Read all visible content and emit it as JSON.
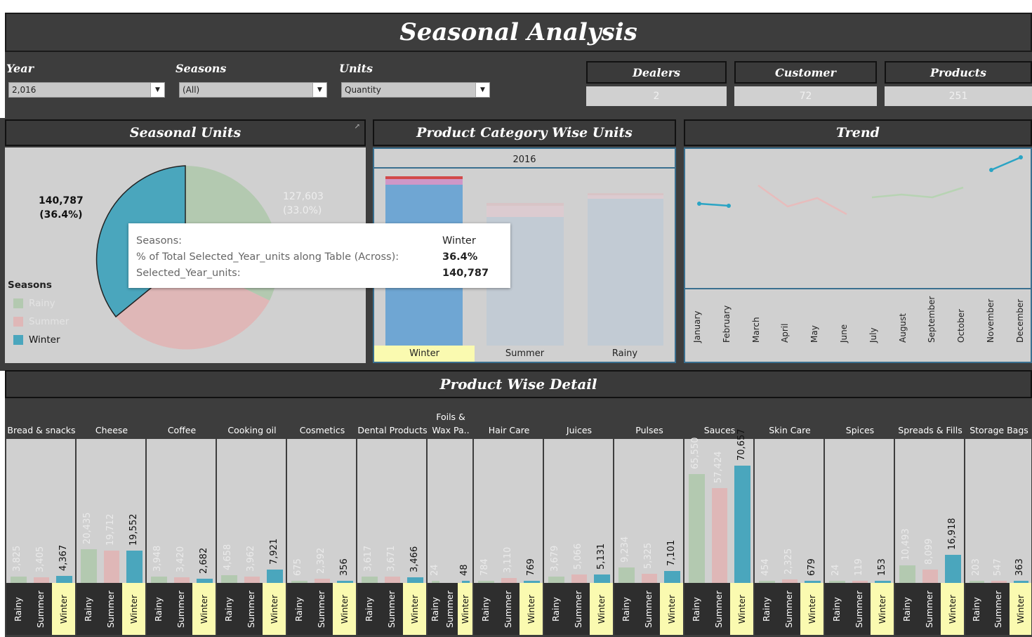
{
  "title": "Seasonal Analysis",
  "filters": {
    "year": {
      "label": "Year",
      "value": "2,016"
    },
    "seasons": {
      "label": "Seasons",
      "value": "(All)"
    },
    "units": {
      "label": "Units",
      "value": "Quantity"
    }
  },
  "kpis": {
    "dealers": {
      "label": "Dealers",
      "value": "2"
    },
    "customer": {
      "label": "Customer",
      "value": "72"
    },
    "products": {
      "label": "Products",
      "value": "251"
    }
  },
  "panels": {
    "seasonal_units": "Seasonal Units",
    "category_units": "Product Category Wise Units",
    "trend": "Trend",
    "detail": "Product Wise Detail"
  },
  "pie": {
    "winter_value": "140,787",
    "winter_pct": "(36.4%)",
    "rainy_value": "127,603",
    "rainy_pct": "(33.0%)",
    "legend_title": "Seasons",
    "legend": [
      "Rainy",
      "Summer",
      "Winter"
    ],
    "colors": {
      "Rainy": "#b3c9b0",
      "Summer": "#dfb7b7",
      "Winter": "#4aa6bd"
    }
  },
  "tooltip": {
    "rows": [
      {
        "k": "Seasons:",
        "v": "Winter"
      },
      {
        "k": "% of Total Selected_Year_units along Table (Across):",
        "v": "36.4%"
      },
      {
        "k": "Selected_Year_units:",
        "v": "140,787"
      }
    ]
  },
  "category_chart": {
    "year_header": "2016",
    "columns": [
      "Winter",
      "Summer",
      "Rainy"
    ]
  },
  "trend": {
    "months": [
      "January",
      "February",
      "March",
      "April",
      "May",
      "June",
      "July",
      "August",
      "September",
      "October",
      "November",
      "December"
    ]
  },
  "chart_data": {
    "type": "bar",
    "title": "Product Wise Detail",
    "series_names": [
      "Rainy",
      "Summer",
      "Winter"
    ],
    "categories": [
      {
        "name": "Bread & snacks",
        "Rainy": 3825,
        "Summer": 3405,
        "Winter": 4367
      },
      {
        "name": "Cheese",
        "Rainy": 20435,
        "Summer": 19712,
        "Winter": 19552
      },
      {
        "name": "Coffee",
        "Rainy": 3948,
        "Summer": 3420,
        "Winter": 2682
      },
      {
        "name": "Cooking oil",
        "Rainy": 4658,
        "Summer": 3962,
        "Winter": 7921
      },
      {
        "name": "Cosmetics",
        "Rainy": 675,
        "Summer": 2392,
        "Winter": 356
      },
      {
        "name": "Dental Products",
        "Rainy": 3617,
        "Summer": 3671,
        "Winter": 3466
      },
      {
        "name": "Foils & Wax Pa..",
        "Rainy": 24,
        "Summer": null,
        "Winter": 48
      },
      {
        "name": "Hair Care",
        "Rainy": 784,
        "Summer": 3110,
        "Winter": 769
      },
      {
        "name": "Juices",
        "Rainy": 3679,
        "Summer": 5066,
        "Winter": 5131
      },
      {
        "name": "Pulses",
        "Rainy": 9234,
        "Summer": 5325,
        "Winter": 7101
      },
      {
        "name": "Sauces",
        "Rainy": 65550,
        "Summer": 57424,
        "Winter": 70657
      },
      {
        "name": "Skin Care",
        "Rainy": 454,
        "Summer": 2325,
        "Winter": 679
      },
      {
        "name": "Spices",
        "Rainy": 24,
        "Summer": 119,
        "Winter": 153
      },
      {
        "name": "Spreads & Fills",
        "Rainy": 10493,
        "Summer": 8099,
        "Winter": 16918
      },
      {
        "name": "Storage Bags",
        "Rainy": 203,
        "Summer": 547,
        "Winter": 363
      }
    ],
    "labels": {
      "Bread & snacks": [
        "3,825",
        "3,405",
        "4,367"
      ],
      "Cheese": [
        "20,435",
        "19,712",
        "19,552"
      ],
      "Coffee": [
        "3,948",
        "3,420",
        "2,682"
      ],
      "Cooking oil": [
        "4,658",
        "3,962",
        "7,921"
      ],
      "Cosmetics": [
        "675",
        "2,392",
        "356"
      ],
      "Dental Products": [
        "3,617",
        "3,671",
        "3,466"
      ],
      "Foils & Wax Pa..": [
        "24",
        "",
        "48"
      ],
      "Hair Care": [
        "784",
        "3,110",
        "769"
      ],
      "Juices": [
        "3,679",
        "5,066",
        "5,131"
      ],
      "Pulses": [
        "9,234",
        "5,325",
        "7,101"
      ],
      "Sauces": [
        "65,550",
        "57,424",
        "70,657"
      ],
      "Skin Care": [
        "454",
        "2,325",
        "679"
      ],
      "Spices": [
        "24",
        "119",
        "153"
      ],
      "Spreads & Fills": [
        "10,493",
        "8,099",
        "16,918"
      ],
      "Storage Bags": [
        "203",
        "547",
        "363"
      ]
    },
    "ylim": [
      0,
      80000
    ]
  }
}
